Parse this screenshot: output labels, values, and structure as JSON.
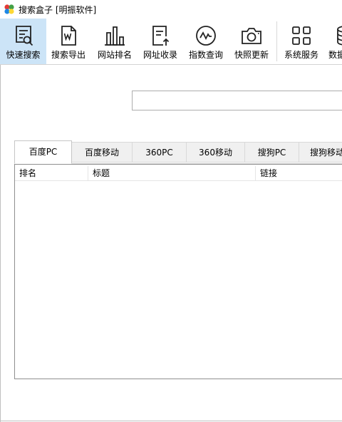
{
  "window": {
    "title": "搜索盒子  [明振软件]",
    "icon": "app-logo-icon"
  },
  "toolbar": {
    "buttons": [
      {
        "label": "快速搜索",
        "icon": "quick-search-icon",
        "active": true
      },
      {
        "label": "搜索导出",
        "icon": "word-export-icon",
        "active": false
      },
      {
        "label": "网站排名",
        "icon": "bar-chart-icon",
        "active": false
      },
      {
        "label": "网址收录",
        "icon": "document-upload-icon",
        "active": false
      },
      {
        "label": "指数查询",
        "icon": "trend-circle-icon",
        "active": false
      },
      {
        "label": "快照更新",
        "icon": "camera-icon",
        "active": false
      },
      {
        "label": "系统服务",
        "icon": "grid-icon",
        "active": false
      },
      {
        "label": "数据",
        "icon": "database-icon",
        "active": false
      }
    ]
  },
  "search": {
    "value": "",
    "placeholder": ""
  },
  "tabs": [
    {
      "label": "百度PC",
      "active": true
    },
    {
      "label": "百度移动",
      "active": false
    },
    {
      "label": "360PC",
      "active": false
    },
    {
      "label": "360移动",
      "active": false
    },
    {
      "label": "搜狗PC",
      "active": false
    },
    {
      "label": "搜狗移动",
      "active": false
    }
  ],
  "table": {
    "columns": [
      "排名",
      "标题",
      "链接"
    ],
    "rows": []
  },
  "colors": {
    "active_toolbar_bg": "#cce4f7",
    "tab_bg": "#f0f0f0",
    "border": "#8f8f8f"
  }
}
